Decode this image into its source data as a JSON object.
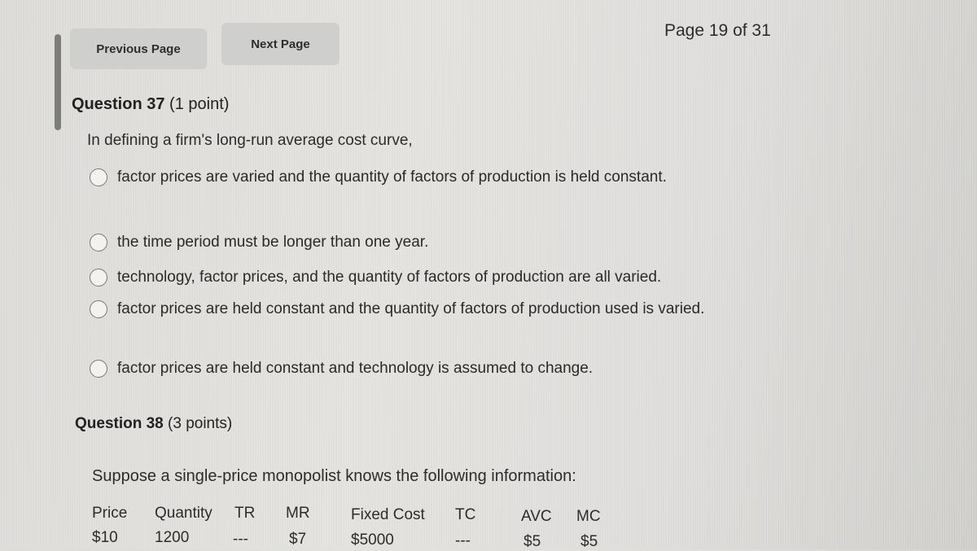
{
  "navigation": {
    "previous_label": "Previous Page",
    "next_label": "Next Page",
    "page_indicator": "Page 19 of 31"
  },
  "question37": {
    "number_label": "Question 37",
    "points_label": "(1 point)",
    "stem": "In defining a firm's long-run average cost curve,",
    "options": [
      {
        "text": "factor prices are varied and the quantity of factors of production is held constant.",
        "selected": false
      },
      {
        "text": "the time period must be longer than one year.",
        "selected": false
      },
      {
        "text": "technology, factor prices, and the quantity of factors of production are all varied.",
        "selected": false
      },
      {
        "text": "factor prices are held constant and the quantity of factors of production used is varied.",
        "selected": false
      },
      {
        "text": "factor prices are held constant and technology is assumed to change.",
        "selected": false
      }
    ]
  },
  "question38": {
    "number_label": "Question 38",
    "points_label": "(3 points)",
    "stem": "Suppose a single-price monopolist knows the following information:",
    "table": {
      "headers": [
        "Price",
        "Quantity",
        "TR",
        "MR",
        "Fixed Cost",
        "TC",
        "AVC",
        "MC"
      ],
      "rows": [
        [
          "$10",
          "1200",
          "---",
          "$7",
          "$5000",
          "---",
          "$5",
          "$5"
        ]
      ]
    }
  }
}
